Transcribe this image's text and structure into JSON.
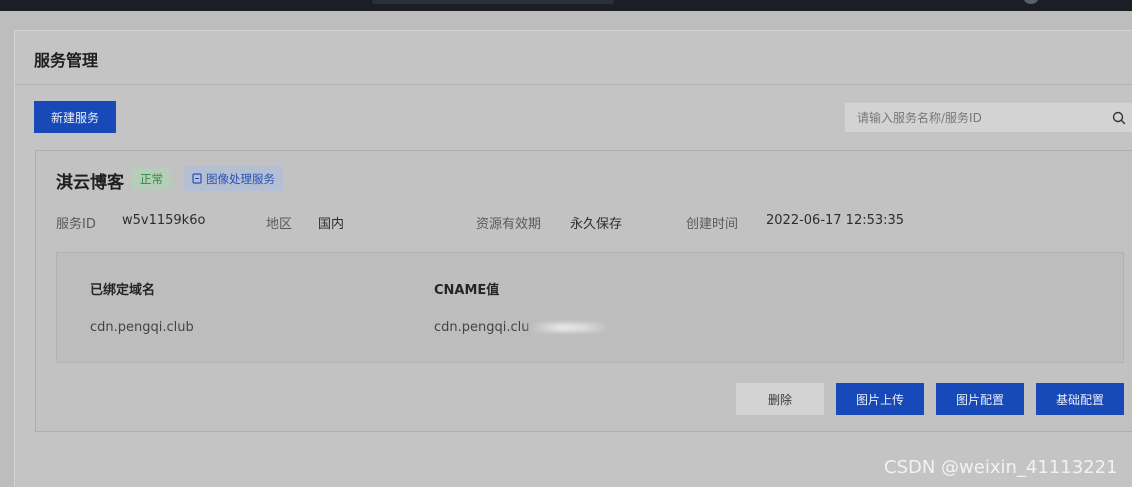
{
  "page": {
    "title": "服务管理",
    "new_service_label": "新建服务",
    "search_placeholder": "请输入服务名称/服务ID"
  },
  "service": {
    "name": "淇云博客",
    "status": "正常",
    "tag": "图像处理服务",
    "meta": {
      "id_label": "服务ID",
      "id_value": "w5v1159k6o",
      "region_label": "地区",
      "region_value": "国内",
      "validity_label": "资源有效期",
      "validity_value": "永久保存",
      "created_label": "创建时间",
      "created_value": "2022-06-17 12:53:35"
    },
    "domains": {
      "col_domain": "已绑定域名",
      "col_cname": "CNAME值",
      "rows": [
        {
          "domain": "cdn.pengqi.club",
          "cname": "cdn.pengqi.clu"
        }
      ]
    },
    "actions": {
      "delete": "删除",
      "upload": "图片上传",
      "image_config": "图片配置",
      "basic_config": "基础配置"
    }
  },
  "watermark": "CSDN @weixin_41113221",
  "colors": {
    "primary": "#1849b8",
    "status_green": "#2f8a40",
    "tag_blue": "#2752b3"
  }
}
